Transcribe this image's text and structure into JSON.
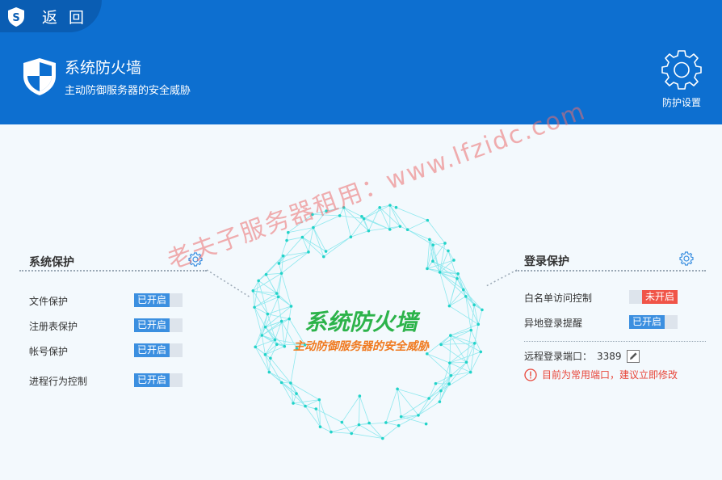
{
  "nav": {
    "back_label": "返 回"
  },
  "header": {
    "title": "系统防火墙",
    "subtitle": "主动防御服务器的安全威胁",
    "settings_label": "防护设置"
  },
  "center": {
    "title": "系统防火墙",
    "subtitle": "主动防御服务器的安全威胁"
  },
  "system_protection": {
    "title": "系统保护",
    "items": [
      {
        "label": "文件保护",
        "status": "已开启",
        "on": true
      },
      {
        "label": "注册表保护",
        "status": "已开启",
        "on": true
      },
      {
        "label": "帐号保护",
        "status": "已开启",
        "on": true
      },
      {
        "label": "进程行为控制",
        "status": "已开启",
        "on": true
      }
    ]
  },
  "login_protection": {
    "title": "登录保护",
    "items": [
      {
        "label": "白名单访问控制",
        "status": "未开启",
        "on": false
      },
      {
        "label": "异地登录提醒",
        "status": "已开启",
        "on": true
      }
    ],
    "port_label": "远程登录端口：",
    "port_value": "3389",
    "warning": "目前为常用端口，建议立即修改"
  },
  "watermark": "老夫子服务器租用：www.lfzidc.com",
  "colors": {
    "header": "#0d6fd0",
    "toggle_on": "#3b8fe0",
    "toggle_off": "#f05448",
    "accent_green": "#2cb34a",
    "accent_orange": "#f07a20"
  }
}
